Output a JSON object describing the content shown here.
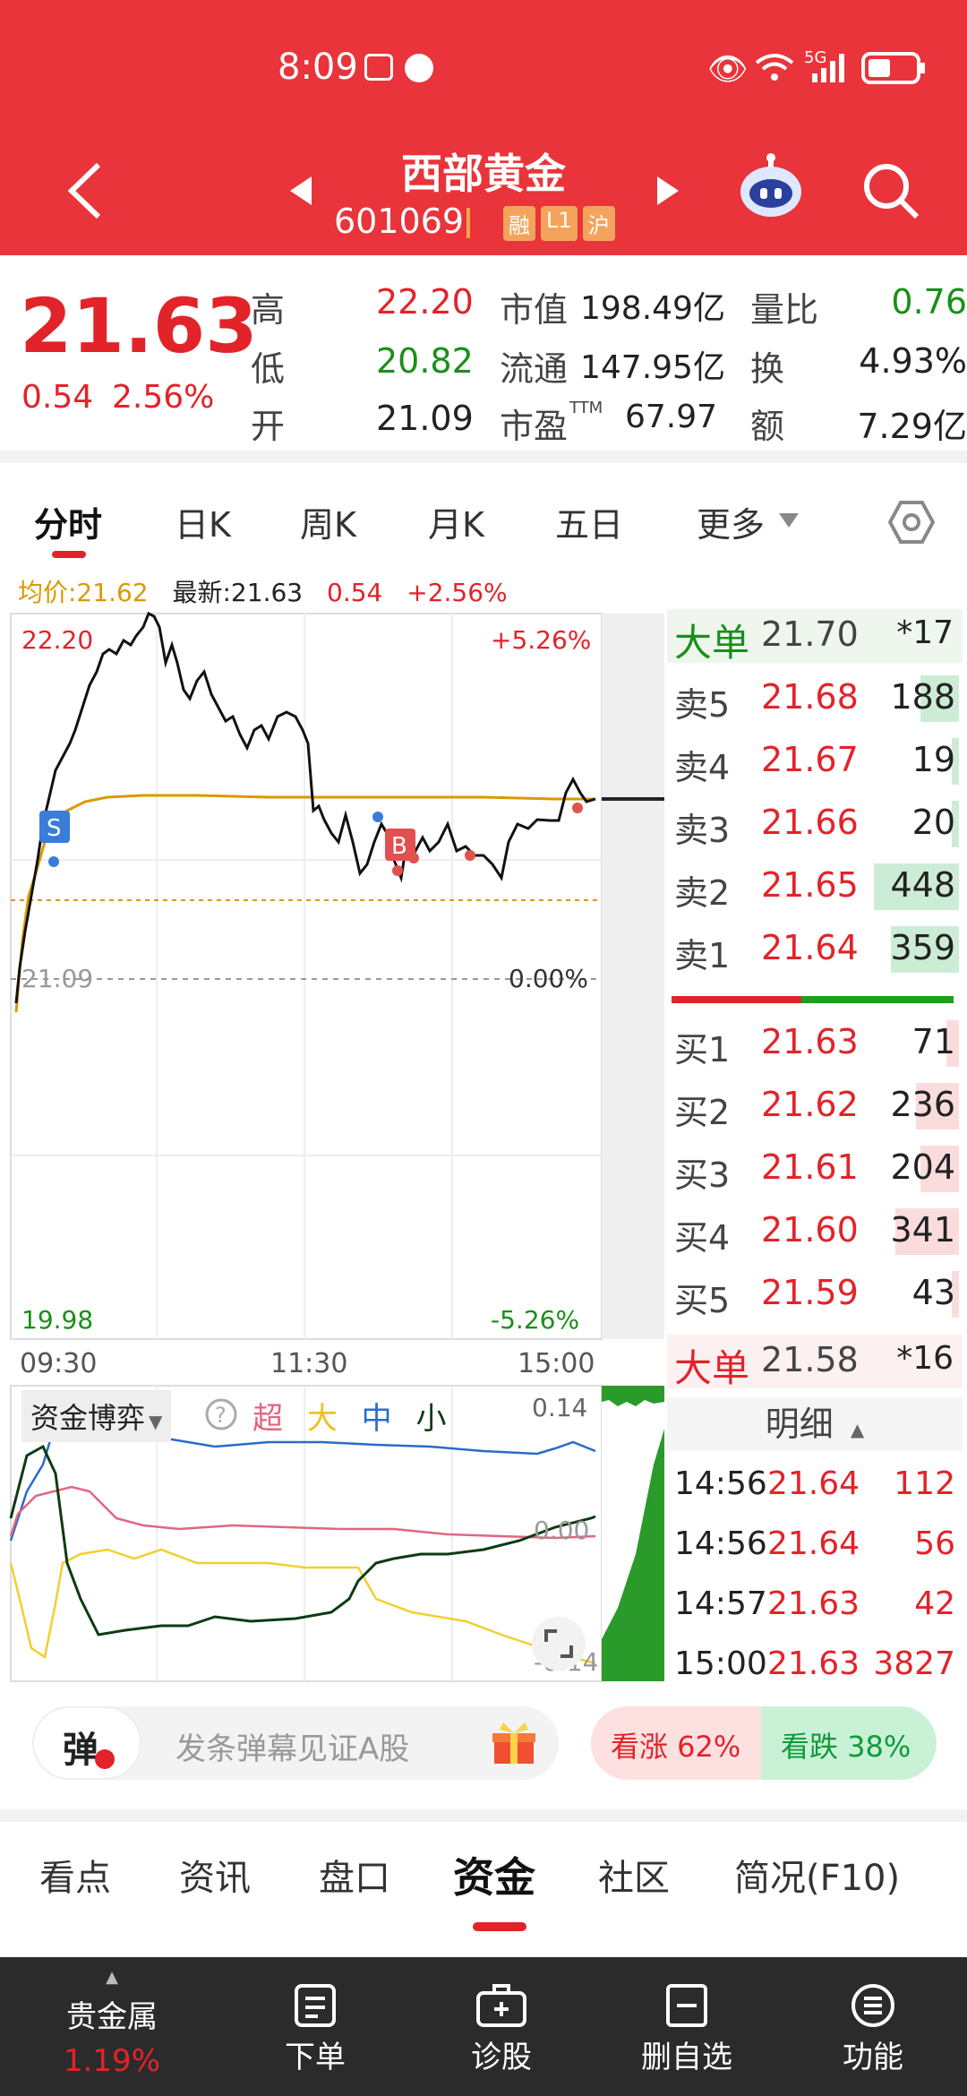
{
  "status": {
    "time": "8:09",
    "network": "5G"
  },
  "header": {
    "title": "西部黄金",
    "code": "601069",
    "tags": [
      "融",
      "L1",
      "沪"
    ]
  },
  "quote": {
    "price": "21.63",
    "change": "0.54",
    "change_pct": "2.56%",
    "high_label": "高",
    "high": "22.20",
    "low_label": "低",
    "low": "20.82",
    "open_label": "开",
    "open": "21.09",
    "mcap_label": "市值",
    "mcap": "198.49亿",
    "float_label": "流通",
    "float": "147.95亿",
    "pe_label": "市盈",
    "pe_sup": "TTM",
    "pe": "67.97",
    "vr_label": "量比",
    "vr": "0.76",
    "turn_label": "换",
    "turn": "4.93%",
    "amt_label": "额",
    "amt": "7.29亿"
  },
  "tabs": [
    "分时",
    "日K",
    "周K",
    "月K",
    "五日",
    "更多"
  ],
  "legend": {
    "avg": "均价:21.62",
    "latest": "最新:21.63",
    "chg": "0.54",
    "pct": "+2.56%"
  },
  "chart": {
    "y_high": "22.20",
    "y_low": "19.98",
    "y_mid": "21.09",
    "pct_high": "+5.26%",
    "pct_low": "-5.26%",
    "pct_mid": "0.00%",
    "x_labels": [
      "09:30",
      "11:30",
      "15:00"
    ],
    "marker_s": "S",
    "marker_b": "B"
  },
  "orderbook": {
    "big_sell": {
      "label": "大单",
      "price": "21.70",
      "count": "*17"
    },
    "asks": [
      {
        "label": "卖5",
        "price": "21.68",
        "vol": "188",
        "fill": 0.45
      },
      {
        "label": "卖4",
        "price": "21.67",
        "vol": "19",
        "fill": 0.05
      },
      {
        "label": "卖3",
        "price": "21.66",
        "vol": "20",
        "fill": 0.05
      },
      {
        "label": "卖2",
        "price": "21.65",
        "vol": "448",
        "fill": 1.0
      },
      {
        "label": "卖1",
        "price": "21.64",
        "vol": "359",
        "fill": 0.8
      }
    ],
    "bids": [
      {
        "label": "买1",
        "price": "21.63",
        "vol": "71",
        "fill": 0.15
      },
      {
        "label": "买2",
        "price": "21.62",
        "vol": "236",
        "fill": 0.5
      },
      {
        "label": "买3",
        "price": "21.61",
        "vol": "204",
        "fill": 0.45
      },
      {
        "label": "买4",
        "price": "21.60",
        "vol": "341",
        "fill": 0.75
      },
      {
        "label": "买5",
        "price": "21.59",
        "vol": "43",
        "fill": 0.08
      }
    ],
    "big_buy": {
      "label": "大单",
      "price": "21.58",
      "count": "*16"
    },
    "detail_label": "明细",
    "trades": [
      {
        "time": "14:56",
        "price": "21.64",
        "vol": "112"
      },
      {
        "time": "14:56",
        "price": "21.64",
        "vol": "56"
      },
      {
        "time": "14:57",
        "price": "21.63",
        "vol": "42"
      },
      {
        "time": "15:00",
        "price": "21.63",
        "vol": "3827"
      }
    ]
  },
  "fund": {
    "selector": "资金博弈",
    "legend": [
      "超",
      "大",
      "中",
      "小"
    ],
    "y_top": "0.14",
    "y_mid": "0.00",
    "y_bot": "-0.14"
  },
  "danmu": {
    "icon": "弹",
    "placeholder": "发条弹幕见证A股",
    "up": "看涨 62%",
    "down": "看跌 38%"
  },
  "bottom_tabs": [
    "看点",
    "资讯",
    "盘口",
    "资金",
    "社区",
    "简况(F10)"
  ],
  "nav": {
    "sector": "贵金属",
    "sector_pct": "1.19%",
    "items": [
      "下单",
      "诊股",
      "删自选",
      "功能"
    ]
  }
}
